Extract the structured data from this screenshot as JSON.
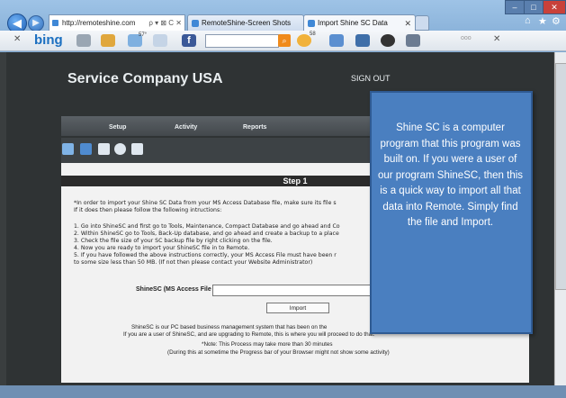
{
  "browser": {
    "address": "http://remoteshine.com",
    "address_controls": "ρ ▾ ⊠ C ✕",
    "tabs": [
      {
        "label": "RemoteShine-Screen Shots"
      },
      {
        "label": "Import Shine SC Data"
      }
    ],
    "tab_close": "✕",
    "toolbar": {
      "logo": "bing",
      "weather": "57°",
      "mail_count": "58",
      "dots": "ooo"
    }
  },
  "site": {
    "company": "Service Company USA",
    "signout": "SIGN OUT",
    "menu": [
      "Setup",
      "Activity",
      "Reports"
    ]
  },
  "form": {
    "step": "Step 1",
    "intro1": "*In order to import your Shine SC  Data from your MS Access Database file, make sure its file s",
    "intro2": "If it does then please follow the following intructions:",
    "steps": [
      "1. Go into ShineSC and first go to Tools, Maintenance, Compact Database and go ahead and Co",
      "2. Within ShineSC go to Tools, Back-Up database, and go ahead and create a backup to a place",
      "3. Check the file size of your SC backup file by right clicking on the file.",
      "4. Now you are ready to import your ShineSC file in to Remote.",
      "5. If you have followed the above instructions correctly, your MS Access File must have been r",
      "    to some size less than 50 MB.  (If not then please contact your Website Administrator)"
    ],
    "file_label": "ShineSC (MS Access File .mdb)",
    "import_button": "Import",
    "note1": "ShineSC is our PC based business management system that has been on the",
    "note2": "If you are a user of ShineSC, and are upgrading to Remote, this is where you will proceed to do that.",
    "note3": "*Note: This Process may take more than 30 minutes",
    "note4": "(During this at sometime the Progress bar of your Browser might not show  some activity)"
  },
  "callout": {
    "text": "Shine SC is a computer program that this program was built on. If you were a user of our program ShineSC, then this is a quick way to import all that data into Remote. Simply find the file and Import."
  }
}
